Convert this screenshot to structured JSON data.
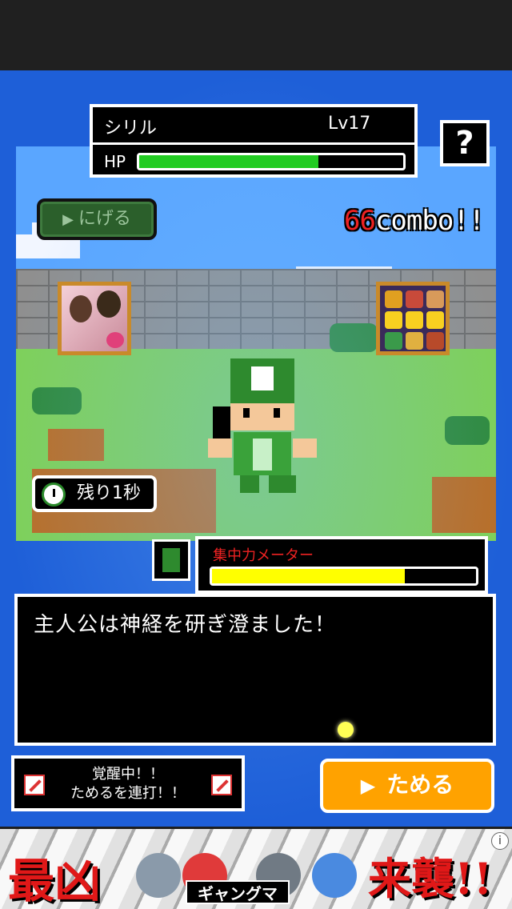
{
  "status": {
    "name": "シリル",
    "level": "Lv17",
    "hp_label": "HP",
    "hp_fraction": 0.68
  },
  "help": {
    "label": "?"
  },
  "run_button": {
    "icon": "play-triangle",
    "label": "にげる"
  },
  "combo": {
    "count": "66",
    "suffix": "combo!!"
  },
  "timer": {
    "icon": "clock-icon",
    "label": "残り1秒"
  },
  "meter": {
    "label": "集中力メーター",
    "fraction": 0.73
  },
  "message": {
    "text": "主人公は神経を研ぎ澄ました！"
  },
  "awake": {
    "line1": "覚醒中！！",
    "line2": "ためるを連打！！"
  },
  "charge_button": {
    "label": "ためる"
  },
  "banner": {
    "left_text": "最凶",
    "logo": "ギャングマ",
    "right_text": "来襲!!",
    "info": "i"
  },
  "colors": {
    "hp": "#22cc22",
    "meter": "#ffff00",
    "combo_number": "#ee2222",
    "charge": "#ffa200",
    "stage_border": "#1e5fd8"
  }
}
